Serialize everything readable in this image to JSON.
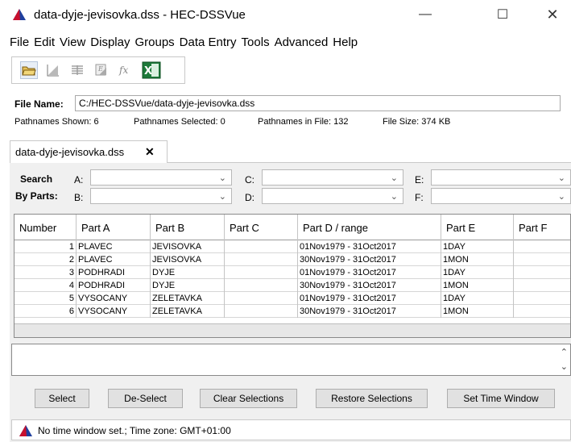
{
  "window": {
    "title": "data-dyje-jevisovka.dss - HEC-DSSVue",
    "minimize": "—",
    "maximize": "☐",
    "close": "✕"
  },
  "menu": [
    "File",
    "Edit",
    "View",
    "Display",
    "Groups",
    "Data Entry",
    "Tools",
    "Advanced",
    "Help"
  ],
  "file": {
    "label": "File Name:",
    "path": "C:/HEC-DSSVue/data-dyje-jevisovka.dss",
    "shown": "Pathnames Shown: 6",
    "selected": "Pathnames Selected: 0",
    "in_file": "Pathnames in File: 132",
    "size": "File Size: 374 KB"
  },
  "tab": {
    "label": "data-dyje-jevisovka.dss",
    "close": "✕"
  },
  "search": {
    "label1": "Search",
    "label2": "By Parts:",
    "parts": [
      "A:",
      "B:",
      "C:",
      "D:",
      "E:",
      "F:"
    ]
  },
  "table": {
    "headers": [
      "Number",
      "Part A",
      "Part B",
      "Part C",
      "Part D / range",
      "Part E",
      "Part F"
    ],
    "rows": [
      [
        "1",
        "PLAVEC",
        "JEVISOVKA",
        "",
        "01Nov1979 - 31Oct2017",
        "1DAY",
        ""
      ],
      [
        "2",
        "PLAVEC",
        "JEVISOVKA",
        "",
        "30Nov1979 - 31Oct2017",
        "1MON",
        ""
      ],
      [
        "3",
        "PODHRADI",
        "DYJE",
        "",
        "01Nov1979 - 31Oct2017",
        "1DAY",
        ""
      ],
      [
        "4",
        "PODHRADI",
        "DYJE",
        "",
        "30Nov1979 - 31Oct2017",
        "1MON",
        ""
      ],
      [
        "5",
        "VYSOCANY",
        "ZELETAVKA",
        "",
        "01Nov1979 - 31Oct2017",
        "1DAY",
        ""
      ],
      [
        "6",
        "VYSOCANY",
        "ZELETAVKA",
        "",
        "30Nov1979 - 31Oct2017",
        "1MON",
        ""
      ]
    ]
  },
  "buttons": {
    "select": "Select",
    "deselect": "De-Select",
    "clear": "Clear Selections",
    "restore": "Restore Selections",
    "time_window": "Set Time Window"
  },
  "status": {
    "text": "No time window set.; Time zone: GMT+01:00"
  },
  "colors": {
    "brand_red": "#c8102e",
    "brand_blue": "#1f3f9e",
    "excel_green": "#1d7a3a"
  }
}
